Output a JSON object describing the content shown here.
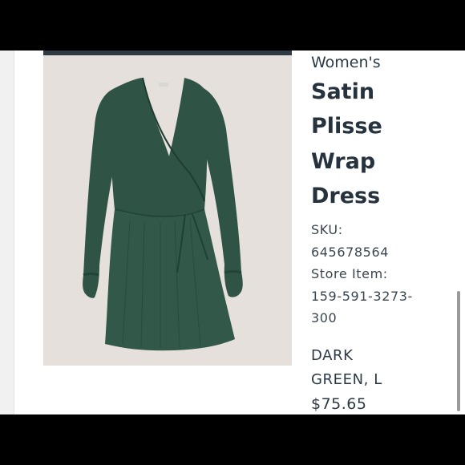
{
  "product": {
    "category": "Women's",
    "title_lines": [
      "Satin",
      "Plisse",
      "Wrap",
      "Dress"
    ],
    "sku_label": "SKU:",
    "sku_value": "645678564",
    "store_item_label": "Store Item:",
    "store_item_value_lines": [
      "159-591-3273-",
      "300"
    ],
    "color_size_lines": [
      "DARK",
      "GREEN, L"
    ],
    "price": "$75.65"
  },
  "colors": {
    "background": "#000000",
    "panel": "#ffffff",
    "text": "#2c3a47",
    "image_bg": "#e6e0dc",
    "dress": "#2f5446"
  },
  "icons": {
    "product_image": "dress-photo"
  }
}
